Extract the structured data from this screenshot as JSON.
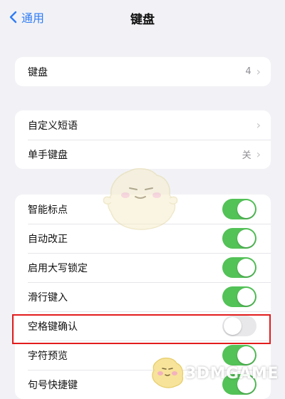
{
  "nav": {
    "back_label": "通用",
    "title": "键盘"
  },
  "keyboards": {
    "label": "键盘",
    "value": "4"
  },
  "text_group": [
    {
      "label": "自定义短语",
      "value": ""
    },
    {
      "label": "单手键盘",
      "value": "关"
    }
  ],
  "toggles": [
    {
      "label": "智能标点",
      "on": true
    },
    {
      "label": "自动改正",
      "on": true
    },
    {
      "label": "启用大写锁定",
      "on": true
    },
    {
      "label": "滑行键入",
      "on": true
    },
    {
      "label": "空格键确认",
      "on": false
    },
    {
      "label": "字符预览",
      "on": true
    },
    {
      "label": "句号快捷键",
      "on": true
    }
  ],
  "watermark": {
    "text": "3DMGAME"
  },
  "colors": {
    "accent": "#2f7cf6",
    "toggle_on": "#53c257",
    "toggle_off": "#e8e8ea",
    "highlight": "#e21c1c",
    "background": "#f2f2f6"
  }
}
